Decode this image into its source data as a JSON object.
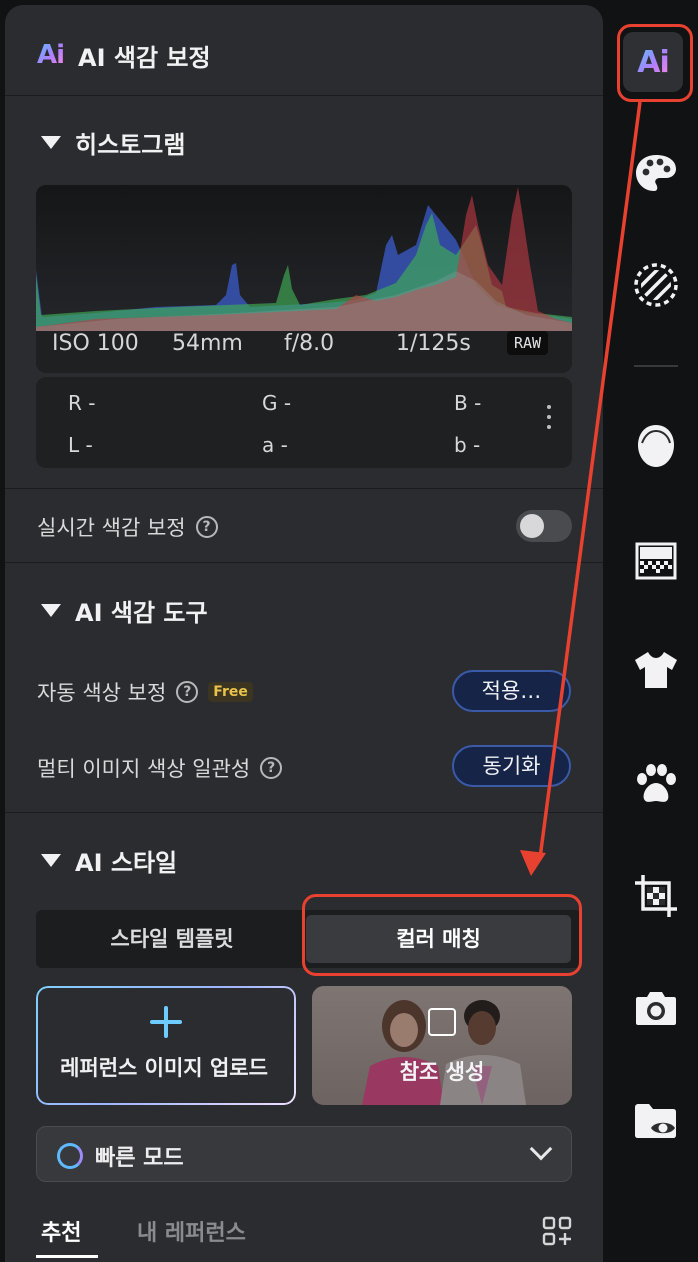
{
  "panel": {
    "title": "AI 색감 보정",
    "histogram": {
      "heading": "히스토그램",
      "iso": "ISO 100",
      "focal_length": "54mm",
      "aperture": "f/8.0",
      "shutter": "1/125s",
      "format_badge": "RAW"
    },
    "color_values": {
      "r": "R -",
      "g": "G -",
      "b": "B -",
      "l": "L -",
      "a": "a -",
      "b2": "b -"
    },
    "realtime": {
      "label": "실시간 색감 보정",
      "enabled": false
    },
    "ai_tools": {
      "heading": "AI 색감 도구",
      "auto_color": {
        "label": "자동 색상 보정",
        "badge": "Free",
        "button": "적용…"
      },
      "multi_consistency": {
        "label": "멀티 이미지 색상 일관성",
        "button": "동기화"
      }
    },
    "ai_style": {
      "heading": "AI 스타일",
      "tabs": [
        "스타일 템플릿",
        "컬러 매칭"
      ],
      "active_tab": "컬러 매칭",
      "upload_label": "레퍼런스 이미지 업로드",
      "reference_label": "참조 생성",
      "mode": "빠른 모드",
      "sub_tabs": [
        "추천",
        "내 레퍼런스"
      ],
      "active_sub_tab": "추천"
    }
  },
  "rail": {
    "icons": [
      "ai-icon",
      "palette-icon",
      "hatch-circle-icon",
      "face-icon",
      "gradient-grid-icon",
      "tshirt-icon",
      "paw-icon",
      "crop-icon",
      "camera-icon",
      "folder-eye-icon"
    ],
    "active": "ai-icon"
  },
  "colors": {
    "panel_bg": "#2b2c2f",
    "accent_blue": "#3a5aa8",
    "annotation_red": "#e8412f"
  }
}
